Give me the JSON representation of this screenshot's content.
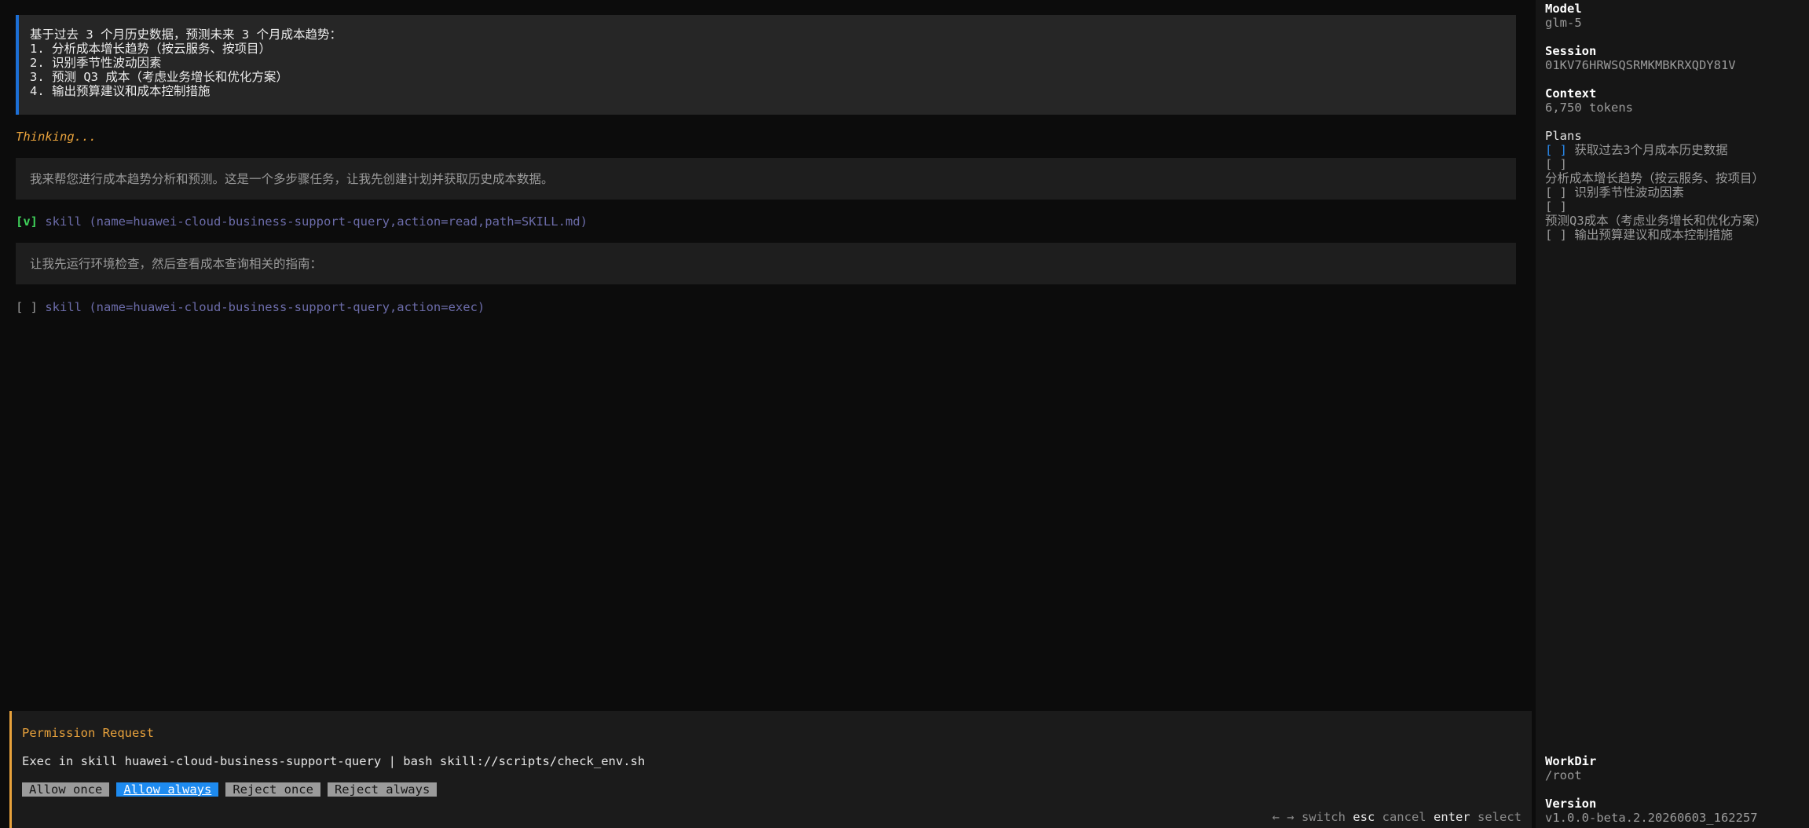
{
  "user_prompt": {
    "lines": [
      "基于过去 3 个月历史数据，预测未来 3 个月成本趋势：",
      "1. 分析成本增长趋势（按云服务、按项目）",
      "2. 识别季节性波动因素",
      "3. 预测 Q3 成本（考虑业务增长和优化方案）",
      "4. 输出预算建议和成本控制措施"
    ]
  },
  "thinking": "Thinking...",
  "messages": [
    "我来帮您进行成本趋势分析和预测。这是一个多步骤任务，让我先创建计划并获取历史成本数据。",
    "让我先运行环境检查，然后查看成本查询相关的指南："
  ],
  "tool_calls": [
    {
      "status": "[v]",
      "text": "skill (name=huawei-cloud-business-support-query,action=read,path=SKILL.md)"
    },
    {
      "status": "[ ]",
      "text": "skill (name=huawei-cloud-business-support-query,action=exec)"
    }
  ],
  "permission": {
    "title": "Permission Request",
    "body": "Exec in skill huawei-cloud-business-support-query | bash skill://scripts/check_env.sh",
    "buttons": [
      "Allow once",
      "Allow always",
      "Reject once",
      "Reject always"
    ],
    "selected": "Allow always"
  },
  "hints": {
    "arrows": "← →",
    "switch": "switch",
    "esc": "esc",
    "cancel": "cancel",
    "enter": "enter",
    "select": "select"
  },
  "sidebar": {
    "model_label": "Model",
    "model_value": "glm-5",
    "session_label": "Session",
    "session_value": "01KV76HRWSQSRMKMBKRXQDY81V",
    "context_label": "Context",
    "context_value": "6,750 tokens",
    "plans_label": "Plans",
    "plans": [
      {
        "box": "[ ]",
        "text": "获取过去3个月成本历史数据"
      },
      {
        "box": "[ ]",
        "text": ""
      },
      {
        "box": "",
        "text": "分析成本增长趋势（按云服务、按项目）"
      },
      {
        "box": "[ ]",
        "text": "识别季节性波动因素"
      },
      {
        "box": "[ ]",
        "text": ""
      },
      {
        "box": "",
        "text": "预测Q3成本（考虑业务增长和优化方案）"
      },
      {
        "box": "[ ]",
        "text": "输出预算建议和成本控制措施"
      }
    ],
    "workdir_label": "WorkDir",
    "workdir_value": "/root",
    "version_label": "Version",
    "version_value": "v1.0.0-beta.2.20260603_162257"
  },
  "colors": {
    "accent_blue": "#1e8bf0",
    "accent_orange": "#e8a23c",
    "check_green": "#3fd15a"
  }
}
